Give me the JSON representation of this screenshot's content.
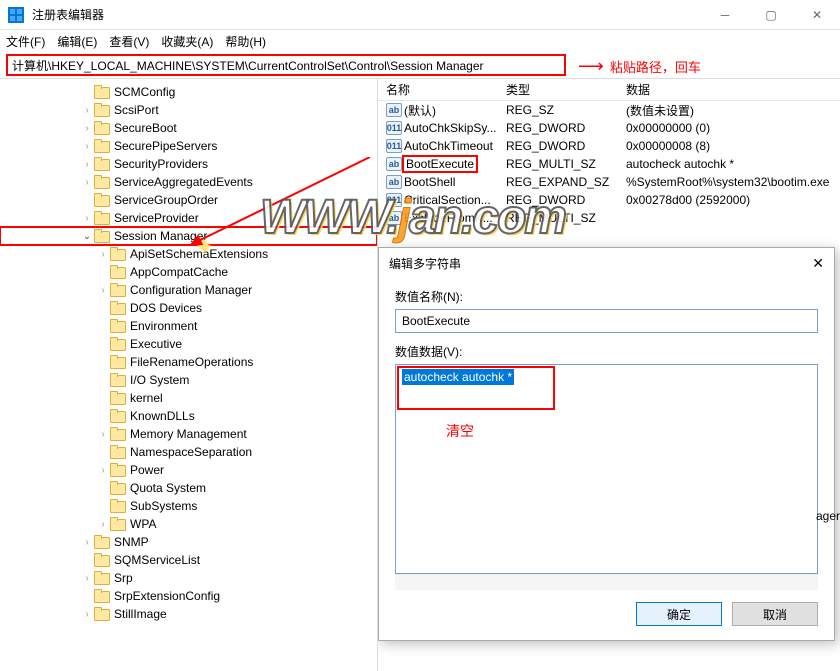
{
  "window": {
    "title": "注册表编辑器"
  },
  "menu": {
    "file": "文件(F)",
    "edit": "编辑(E)",
    "view": "查看(V)",
    "favorites": "收藏夹(A)",
    "help": "帮助(H)"
  },
  "address": {
    "path": "计算机\\HKEY_LOCAL_MACHINE\\SYSTEM\\CurrentControlSet\\Control\\Session Manager",
    "annotation": "粘贴路径，回车"
  },
  "tree": [
    {
      "indent": 5,
      "label": "SCMConfig",
      "chev": ""
    },
    {
      "indent": 5,
      "label": "ScsiPort",
      "chev": ">"
    },
    {
      "indent": 5,
      "label": "SecureBoot",
      "chev": ">"
    },
    {
      "indent": 5,
      "label": "SecurePipeServers",
      "chev": ">"
    },
    {
      "indent": 5,
      "label": "SecurityProviders",
      "chev": ">"
    },
    {
      "indent": 5,
      "label": "ServiceAggregatedEvents",
      "chev": ">"
    },
    {
      "indent": 5,
      "label": "ServiceGroupOrder",
      "chev": ""
    },
    {
      "indent": 5,
      "label": "ServiceProvider",
      "chev": ">"
    },
    {
      "indent": 5,
      "label": "Session Manager",
      "chev": "v",
      "highlight": true
    },
    {
      "indent": 6,
      "label": "ApiSetSchemaExtensions",
      "chev": ">"
    },
    {
      "indent": 6,
      "label": "AppCompatCache",
      "chev": ""
    },
    {
      "indent": 6,
      "label": "Configuration Manager",
      "chev": ">"
    },
    {
      "indent": 6,
      "label": "DOS Devices",
      "chev": ""
    },
    {
      "indent": 6,
      "label": "Environment",
      "chev": ""
    },
    {
      "indent": 6,
      "label": "Executive",
      "chev": ""
    },
    {
      "indent": 6,
      "label": "FileRenameOperations",
      "chev": ""
    },
    {
      "indent": 6,
      "label": "I/O System",
      "chev": ""
    },
    {
      "indent": 6,
      "label": "kernel",
      "chev": ""
    },
    {
      "indent": 6,
      "label": "KnownDLLs",
      "chev": ""
    },
    {
      "indent": 6,
      "label": "Memory Management",
      "chev": ">"
    },
    {
      "indent": 6,
      "label": "NamespaceSeparation",
      "chev": ""
    },
    {
      "indent": 6,
      "label": "Power",
      "chev": ">"
    },
    {
      "indent": 6,
      "label": "Quota System",
      "chev": ""
    },
    {
      "indent": 6,
      "label": "SubSystems",
      "chev": ""
    },
    {
      "indent": 6,
      "label": "WPA",
      "chev": ">"
    },
    {
      "indent": 5,
      "label": "SNMP",
      "chev": ">"
    },
    {
      "indent": 5,
      "label": "SQMServiceList",
      "chev": ""
    },
    {
      "indent": 5,
      "label": "Srp",
      "chev": ">"
    },
    {
      "indent": 5,
      "label": "SrpExtensionConfig",
      "chev": ""
    },
    {
      "indent": 5,
      "label": "StillImage",
      "chev": ">"
    }
  ],
  "list": {
    "headers": {
      "name": "名称",
      "type": "类型",
      "data": "数据"
    },
    "rows": [
      {
        "icon": "ab",
        "name": "(默认)",
        "type": "REG_SZ",
        "data": "(数值未设置)"
      },
      {
        "icon": "bin",
        "name": "AutoChkSkipSy...",
        "type": "REG_DWORD",
        "data": "0x00000000 (0)"
      },
      {
        "icon": "bin",
        "name": "AutoChkTimeout",
        "type": "REG_DWORD",
        "data": "0x00000008 (8)"
      },
      {
        "icon": "ab",
        "name": "BootExecute",
        "type": "REG_MULTI_SZ",
        "data": "autocheck autochk *",
        "highlight": true
      },
      {
        "icon": "ab",
        "name": "BootShell",
        "type": "REG_EXPAND_SZ",
        "data": "%SystemRoot%\\system32\\bootim.exe"
      },
      {
        "icon": "bin",
        "name": "CriticalSection...",
        "type": "REG_DWORD",
        "data": "0x00278d00 (2592000)"
      },
      {
        "icon": "ab",
        "name": "ExcludeFromK...",
        "type": "REG_MULTI_SZ",
        "data": ""
      }
    ]
  },
  "dialog": {
    "title": "编辑多字符串",
    "name_label": "数值名称(N):",
    "name_value": "BootExecute",
    "data_label": "数值数据(V):",
    "data_value": "autocheck autochk *",
    "clear_annotation": "清空",
    "ok": "确定",
    "cancel": "取消"
  },
  "overflow": "ager",
  "watermark": {
    "w": "WWW.",
    "mid": "    ",
    "j": "j",
    "rest": "an.com"
  }
}
